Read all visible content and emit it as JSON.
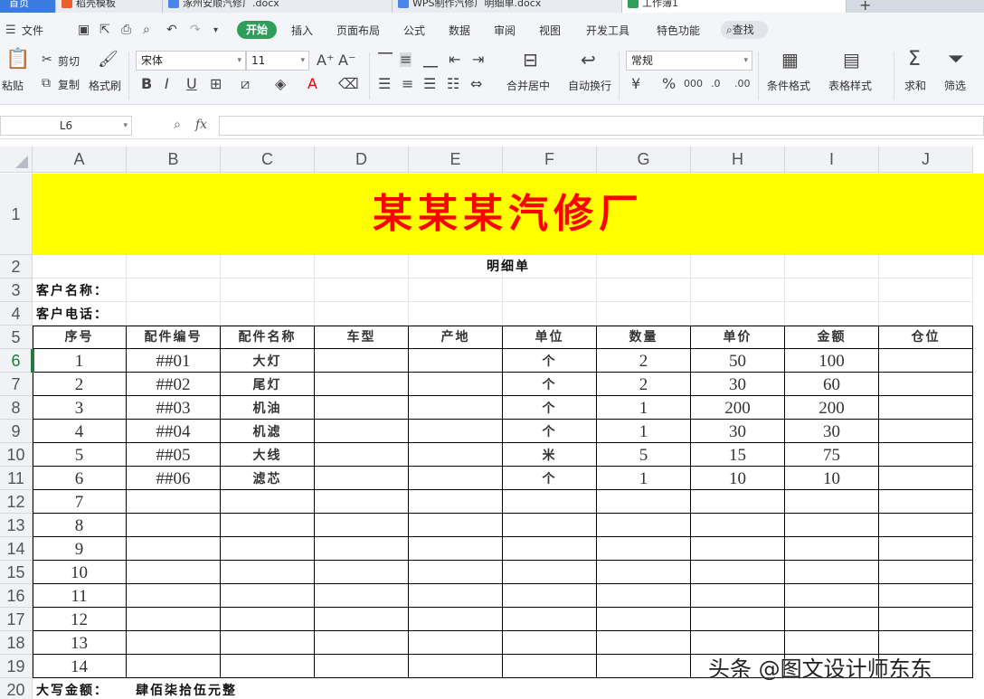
{
  "tabs": [
    {
      "label": "首页",
      "kind": "home"
    },
    {
      "label": "稻壳模板",
      "kind": "normal"
    },
    {
      "label": "涿州安顺汽修厂.docx",
      "kind": "normal"
    },
    {
      "label": "WPS制作汽修厂明细单.docx",
      "kind": "normal"
    },
    {
      "label": "工作簿1",
      "kind": "active"
    }
  ],
  "menu": {
    "file": "文件",
    "start": "开始",
    "items": [
      "插入",
      "页面布局",
      "公式",
      "数据",
      "审阅",
      "视图",
      "开发工具",
      "特色功能"
    ],
    "search": "查找"
  },
  "ribbon": {
    "paste": "粘贴",
    "cut": "剪切",
    "copy": "复制",
    "format_painter": "格式刷",
    "font_name": "宋体",
    "font_size": "11",
    "merge_center": "合并居中",
    "wrap_text": "自动换行",
    "number_format": "常规",
    "conditional_format": "条件格式",
    "table_style": "表格样式",
    "sum": "求和",
    "filter": "筛选"
  },
  "formula_bar": {
    "name_box": "L6",
    "formula_value": ""
  },
  "columns": [
    "A",
    "B",
    "C",
    "D",
    "E",
    "F",
    "G",
    "H",
    "I",
    "J"
  ],
  "rows": [
    "1",
    "2",
    "3",
    "4",
    "5",
    "6",
    "7",
    "8",
    "9",
    "10",
    "11",
    "12",
    "13",
    "14",
    "15",
    "16",
    "17",
    "18",
    "19",
    "20"
  ],
  "selected_row": "6",
  "sheet": {
    "title": "某某某汽修厂",
    "subtitle": "明细单",
    "customer_name_label": "客户名称：",
    "customer_phone_label": "客户电话：",
    "headers": [
      "序号",
      "配件编号",
      "配件名称",
      "车型",
      "产地",
      "单位",
      "数量",
      "单价",
      "金额",
      "仓位"
    ],
    "data_rows": [
      [
        "1",
        "##01",
        "大灯",
        "",
        "",
        "个",
        "2",
        "50",
        "100",
        ""
      ],
      [
        "2",
        "##02",
        "尾灯",
        "",
        "",
        "个",
        "2",
        "30",
        "60",
        ""
      ],
      [
        "3",
        "##03",
        "机油",
        "",
        "",
        "个",
        "1",
        "200",
        "200",
        ""
      ],
      [
        "4",
        "##04",
        "机滤",
        "",
        "",
        "个",
        "1",
        "30",
        "30",
        ""
      ],
      [
        "5",
        "##05",
        "大线",
        "",
        "",
        "米",
        "5",
        "15",
        "75",
        ""
      ],
      [
        "6",
        "##06",
        "滤芯",
        "",
        "",
        "个",
        "1",
        "10",
        "10",
        ""
      ],
      [
        "7",
        "",
        "",
        "",
        "",
        "",
        "",
        "",
        "",
        ""
      ],
      [
        "8",
        "",
        "",
        "",
        "",
        "",
        "",
        "",
        "",
        ""
      ],
      [
        "9",
        "",
        "",
        "",
        "",
        "",
        "",
        "",
        "",
        ""
      ],
      [
        "10",
        "",
        "",
        "",
        "",
        "",
        "",
        "",
        "",
        ""
      ],
      [
        "11",
        "",
        "",
        "",
        "",
        "",
        "",
        "",
        "",
        ""
      ],
      [
        "12",
        "",
        "",
        "",
        "",
        "",
        "",
        "",
        "",
        ""
      ],
      [
        "13",
        "",
        "",
        "",
        "",
        "",
        "",
        "",
        "",
        ""
      ],
      [
        "14",
        "",
        "",
        "",
        "",
        "",
        "",
        "",
        "",
        ""
      ]
    ],
    "total_label": "大写金额：",
    "total_value": "肆佰柒拾伍元整"
  },
  "watermark": "头条 @图文设计师东东",
  "colors": {
    "title_bg": "#ffff00",
    "title_text": "#ff0000",
    "start_green": "#2f9e5b",
    "home_tab": "#3a7be0"
  }
}
